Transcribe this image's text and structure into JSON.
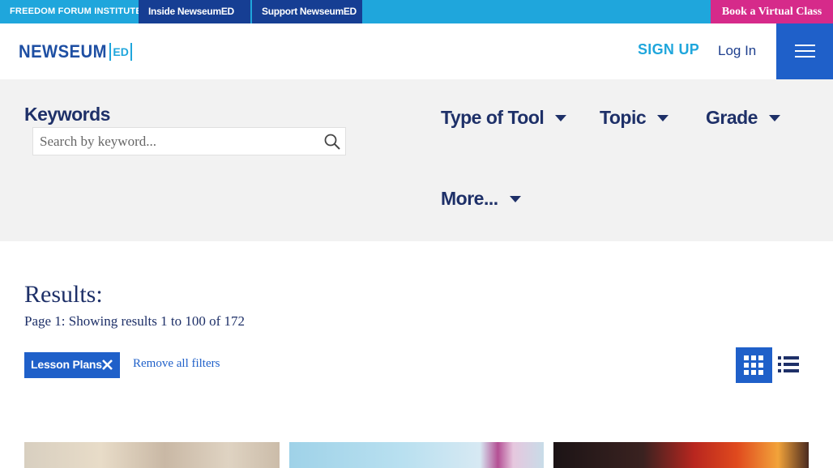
{
  "topbar": {
    "institute": "FREEDOM FORUM INSTITUTE",
    "tab_inside": "Inside NewseumED",
    "tab_support": "Support NewseumED",
    "book_button": "Book a Virtual Class"
  },
  "header": {
    "logo_main": "NEWSEUM",
    "logo_ed": "ED",
    "signup": "SIGN UP",
    "login": "Log In",
    "menu_icon": "hamburger-menu-icon"
  },
  "filters": {
    "keywords_label": "Keywords",
    "search_placeholder": "Search by keyword...",
    "search_icon": "search-icon",
    "type_of_tool": "Type of Tool",
    "topic": "Topic",
    "grade": "Grade",
    "more": "More..."
  },
  "results": {
    "title": "Results:",
    "count_text": "Page 1: Showing results 1 to 100 of 172",
    "active_filter": "Lesson Plans",
    "remove_all": "Remove all filters",
    "grid_view_icon": "grid-view-icon",
    "list_view_icon": "list-view-icon"
  },
  "colors": {
    "topbar_blue": "#1fa6dc",
    "tab_navy": "#163e93",
    "book_pink": "#d62a8a",
    "primary_blue": "#1f60c9",
    "text_navy": "#1e3068"
  }
}
